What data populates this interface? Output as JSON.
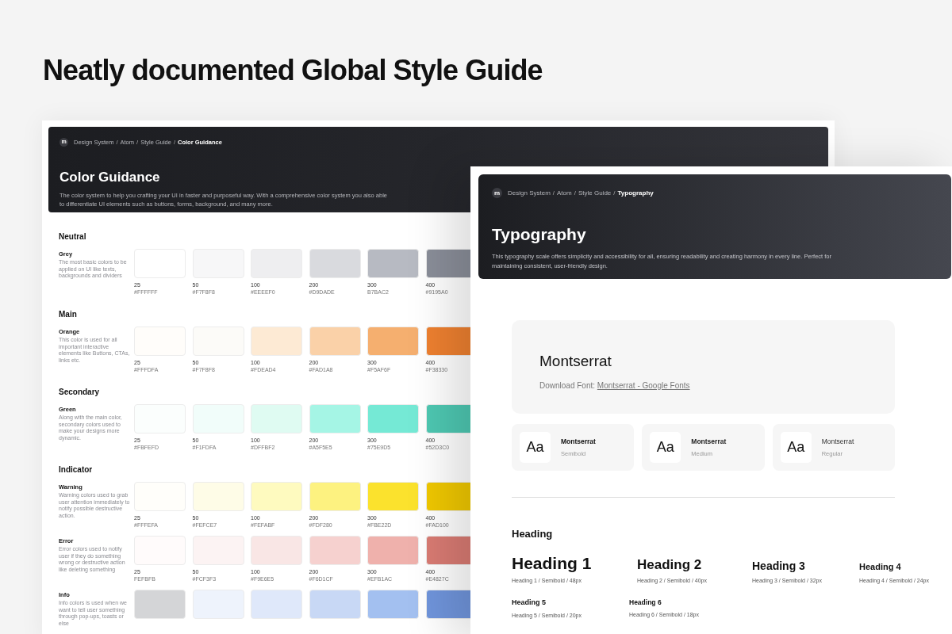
{
  "headline": "Neatly documented Global Style Guide",
  "color_page": {
    "logo": "m",
    "breadcrumb_separator": "/",
    "breadcrumb": [
      {
        "label": "Design System",
        "current": false
      },
      {
        "label": "Atom",
        "current": false
      },
      {
        "label": "Style Guide",
        "current": false
      },
      {
        "label": "Color Guidance",
        "current": true
      }
    ],
    "title": "Color Guidance",
    "description": "The color system to help you crafting your UI in faster and purposeful way. With a comprehensive color system you also able to differentiate UI elements such as buttons, forms, background, and many more.",
    "sections": [
      {
        "title": "Neutral",
        "groups": [
          {
            "name": "Grey",
            "description": "The most basic colors to be applied on UI like texts, backgrounds and dividers",
            "swatches": [
              {
                "step": "25",
                "hex": "#FFFFFF",
                "color": "#ffffff"
              },
              {
                "step": "50",
                "hex": "#F7F8F8",
                "color": "#f7f7f8"
              },
              {
                "step": "100",
                "hex": "#EEEEF0",
                "color": "#eeeef0"
              },
              {
                "step": "200",
                "hex": "#D9DADE",
                "color": "#d9dade"
              },
              {
                "step": "300",
                "hex": "B7BAC2",
                "color": "#b7bac2"
              },
              {
                "step": "400",
                "hex": "#9195A0",
                "color": "#8a8e99"
              }
            ]
          }
        ]
      },
      {
        "title": "Main",
        "groups": [
          {
            "name": "Orange",
            "description": "This color is used for all important interactive elements like Buttons, CTAs, links etc.",
            "swatches": [
              {
                "step": "25",
                "hex": "#FFFDFA",
                "color": "#fffdfa"
              },
              {
                "step": "50",
                "hex": "#F7F8F8",
                "color": "#fcfbf8"
              },
              {
                "step": "100",
                "hex": "#FDEAD4",
                "color": "#fdead4"
              },
              {
                "step": "200",
                "hex": "#FAD1A8",
                "color": "#fad1a8"
              },
              {
                "step": "300",
                "hex": "#F5AF6F",
                "color": "#f5af6f"
              },
              {
                "step": "400",
                "hex": "#F38330",
                "color": "#ee8030"
              }
            ]
          }
        ]
      },
      {
        "title": "Secondary",
        "groups": [
          {
            "name": "Green",
            "description": "Along with the main color, secondary colors used to make your designs more dynamic.",
            "swatches": [
              {
                "step": "25",
                "hex": "#FBFEFD",
                "color": "#fbfefd"
              },
              {
                "step": "50",
                "hex": "#F1FDFA",
                "color": "#f1fdfa"
              },
              {
                "step": "100",
                "hex": "#DFFBF2",
                "color": "#dffbf2"
              },
              {
                "step": "200",
                "hex": "#A5F5E5",
                "color": "#a5f5e5"
              },
              {
                "step": "300",
                "hex": "#75E9D5",
                "color": "#75e9d5"
              },
              {
                "step": "400",
                "hex": "#52D3C0",
                "color": "#4ec8b2"
              }
            ]
          }
        ]
      },
      {
        "title": "Indicator",
        "groups": [
          {
            "name": "Warning",
            "description": "Warning colors used to grab user attention immediately to notify possible destructive action.",
            "swatches": [
              {
                "step": "25",
                "hex": "#FFFEFA",
                "color": "#fffefa"
              },
              {
                "step": "50",
                "hex": "#FEFCE7",
                "color": "#fefce7"
              },
              {
                "step": "100",
                "hex": "#FEFABF",
                "color": "#fefabf"
              },
              {
                "step": "200",
                "hex": "#FDF280",
                "color": "#fdf280"
              },
              {
                "step": "300",
                "hex": "#FBE22D",
                "color": "#fbe22d"
              },
              {
                "step": "400",
                "hex": "#FAD100",
                "color": "#f0c800"
              }
            ]
          },
          {
            "name": "Error",
            "description": "Error colors used to notify user if they do something wrong or destructive action like deleting something",
            "swatches": [
              {
                "step": "25",
                "hex": "FEFBFB",
                "color": "#fffbfb"
              },
              {
                "step": "50",
                "hex": "#FCF3F3",
                "color": "#fcf3f3"
              },
              {
                "step": "100",
                "hex": "#F9E6E5",
                "color": "#f9e6e5"
              },
              {
                "step": "200",
                "hex": "#F6D1CF",
                "color": "#f6d1cf"
              },
              {
                "step": "300",
                "hex": "#EFB1AC",
                "color": "#efb1ac"
              },
              {
                "step": "400",
                "hex": "#E4827C",
                "color": "#d97b73"
              }
            ]
          },
          {
            "name": "Info",
            "description": "Info colors is used when we want to tell user something through pop-ups, toasts or else",
            "swatches": [
              {
                "color": "#d4d5d7"
              },
              {
                "color": "#eef3fc"
              },
              {
                "color": "#dfe8fa"
              },
              {
                "color": "#c8d8f5"
              },
              {
                "color": "#a3c0f0"
              },
              {
                "color": "#7095dc"
              }
            ]
          }
        ]
      }
    ]
  },
  "typography_page": {
    "logo": "m",
    "breadcrumb_separator": "/",
    "breadcrumb": [
      {
        "label": "Design System",
        "current": false
      },
      {
        "label": "Atom",
        "current": false
      },
      {
        "label": "Style Guide",
        "current": false
      },
      {
        "label": "Typography",
        "current": true
      }
    ],
    "title": "Typography",
    "description": "This typography scale offers simplicity and accessibility for all, ensuring readability and creating harmony in every line. Perfect for maintaining consistent, user-friendly design.",
    "font_name": "Montserrat",
    "download_label": "Download Font:",
    "download_link": "Montserrat - Google Fonts",
    "weights": [
      {
        "sample": "Aa",
        "name": "Montserrat",
        "weight": "Semibold",
        "kind": "semibold"
      },
      {
        "sample": "Aa",
        "name": "Montserrat",
        "weight": "Medium",
        "kind": "medium"
      },
      {
        "sample": "Aa",
        "name": "Montserrat",
        "weight": "Regular",
        "kind": "regular"
      }
    ],
    "heading_title": "Heading",
    "headings": [
      {
        "label": "Heading 1",
        "spec": "Heading 1 / Semibold / 48px",
        "kind": "h1"
      },
      {
        "label": "Heading 2",
        "spec": "Heading 2 / Semibold / 40px",
        "kind": "h2"
      },
      {
        "label": "Heading 3",
        "spec": "Heading 3 / Semibold / 32px",
        "kind": "h3"
      },
      {
        "label": "Heading 4",
        "spec": "Heading 4 / Semibold / 24px",
        "kind": "h4"
      },
      {
        "label": "Heading 5",
        "spec": "Heading 5 / Semibold / 20px",
        "kind": "h5"
      },
      {
        "label": "Heading 6",
        "spec": "Heading 6 / Semibold / 18px",
        "kind": "h6"
      }
    ]
  }
}
